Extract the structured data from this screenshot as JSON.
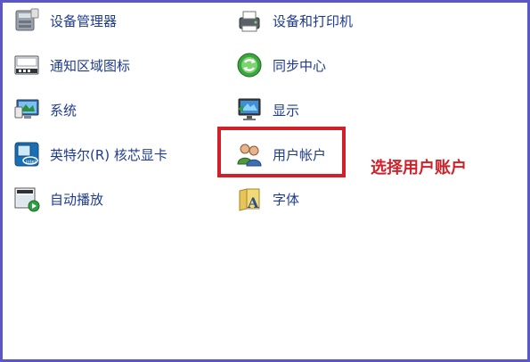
{
  "items": [
    {
      "label": "设备管理器",
      "icon": "device-manager-icon"
    },
    {
      "label": "设备和打印机",
      "icon": "devices-and-printers-icon"
    },
    {
      "label": "通知区域图标",
      "icon": "notification-area-icons-icon"
    },
    {
      "label": "同步中心",
      "icon": "sync-center-icon"
    },
    {
      "label": "系统",
      "icon": "system-icon"
    },
    {
      "label": "显示",
      "icon": "display-icon"
    },
    {
      "label": "英特尔(R) 核芯显卡",
      "icon": "intel-graphics-icon"
    },
    {
      "label": "用户帐户",
      "icon": "user-accounts-icon"
    },
    {
      "label": "自动播放",
      "icon": "autoplay-icon"
    },
    {
      "label": "字体",
      "icon": "fonts-icon"
    }
  ],
  "annotation": {
    "text": "选择用户账户",
    "color": "#d0212a"
  },
  "colors": {
    "link_text": "#1e3b8f",
    "frame_border": "#5b57c8",
    "highlight_border": "#d0212a"
  }
}
